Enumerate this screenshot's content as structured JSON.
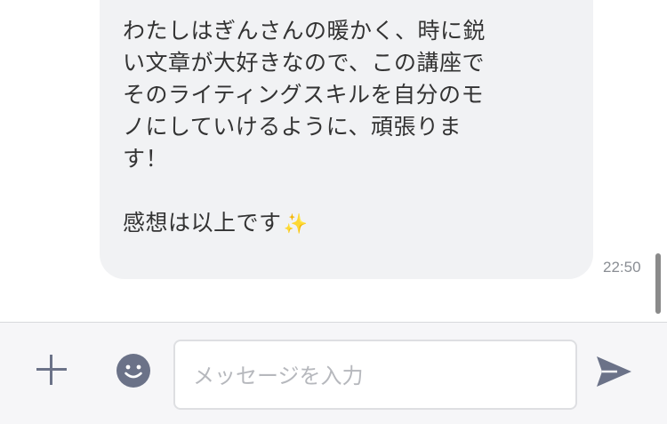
{
  "conversation": {
    "message": {
      "lines": [
        "わたしはぎんさんの暖かく、時に鋭",
        "い文章が大好きなので、この講座で",
        "そのライティングスキルを自分のモ",
        "ノにしていけるように、頑張りま",
        "す！",
        "",
        "感想は以上です"
      ],
      "trailing_emoji": "✨",
      "time": "22:50"
    }
  },
  "composer": {
    "input_placeholder": "メッセージを入力",
    "input_value": "",
    "icons": {
      "add": "plus-icon",
      "emoji": "smiley-icon",
      "send": "send-icon"
    },
    "icon_color": "#6b7288"
  }
}
